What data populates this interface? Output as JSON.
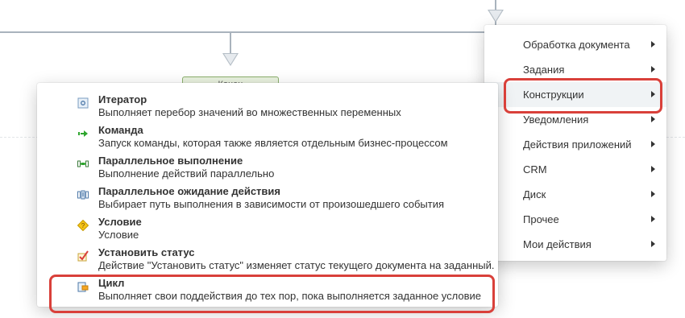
{
  "designer": {
    "end_block_label": "Конец"
  },
  "context_menu": {
    "items": [
      {
        "label": "Обработка документа"
      },
      {
        "label": "Задания"
      },
      {
        "label": "Конструкции"
      },
      {
        "label": "Уведомления"
      },
      {
        "label": "Действия приложений"
      },
      {
        "label": "CRM"
      },
      {
        "label": "Диск"
      },
      {
        "label": "Прочее"
      },
      {
        "label": "Мои действия"
      }
    ]
  },
  "submenu": {
    "items": [
      {
        "title": "Итератор",
        "description": "Выполняет перебор значений во множественных переменных",
        "icon": "iterator-icon"
      },
      {
        "title": "Команда",
        "description": "Запуск команды, которая также является отдельным бизнес-процессом",
        "icon": "command-icon"
      },
      {
        "title": "Параллельное выполнение",
        "description": "Выполнение действий параллельно",
        "icon": "parallel-icon"
      },
      {
        "title": "Параллельное ожидание действия",
        "description": "Выбирает путь выполнения в зависимости от произошедшего события",
        "icon": "parallel-wait-icon"
      },
      {
        "title": "Условие",
        "description": "Условие",
        "icon": "condition-icon"
      },
      {
        "title": "Установить статус",
        "description": "Действие \"Установить статус\" изменяет статус текущего документа на заданный.",
        "icon": "set-status-icon"
      },
      {
        "title": "Цикл",
        "description": "Выполняет свои поддействия до тех пор, пока выполняется заданное условие",
        "icon": "loop-icon"
      }
    ]
  },
  "colors": {
    "highlight_frame": "#d9403a",
    "connector": "#a9b3bd"
  }
}
